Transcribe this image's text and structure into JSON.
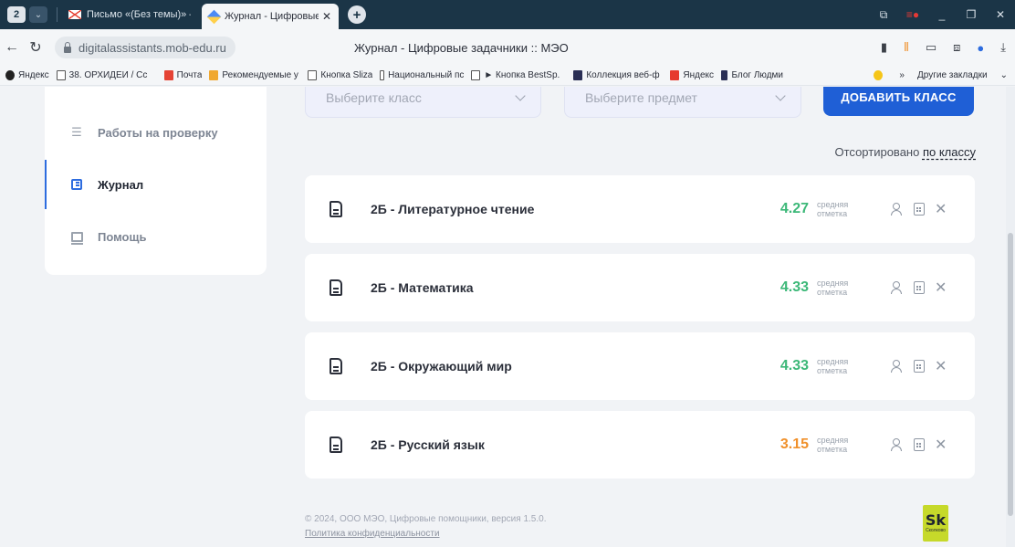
{
  "browser": {
    "tab_count": "2",
    "tabs": [
      {
        "title": "Письмо «(Без темы)» — М",
        "icon": "gmail-icon"
      },
      {
        "title": "Журнал - Цифровые за",
        "icon": "app-icon"
      }
    ],
    "url": "digitalassistants.mob-edu.ru",
    "page_title": "Журнал - Цифровые задачники :: МЭО",
    "bookmarks": [
      {
        "label": "Яндекс",
        "icon": "yandex-icon"
      },
      {
        "label": "38. ОРХИДЕИ / Сс",
        "icon": "page-icon"
      },
      {
        "label": "Почта",
        "icon": "mail-icon"
      },
      {
        "label": "Рекомендуемые у",
        "icon": "recommended-icon"
      },
      {
        "label": "Кнопка Sliza",
        "icon": "page-icon"
      },
      {
        "label": "Национальный пс",
        "icon": "page-icon"
      },
      {
        "label": "► Кнопка BestSp.",
        "icon": "page-icon"
      },
      {
        "label": "Коллекция веб-ф",
        "icon": "collection-icon"
      },
      {
        "label": "Яндекс",
        "icon": "yandex-icon"
      },
      {
        "label": "Блог Людми",
        "icon": "blog-icon"
      }
    ],
    "more_bookmarks": "»",
    "other_bookmarks": "Другие закладки"
  },
  "sidebar": {
    "items": [
      {
        "label": "Работы на проверку",
        "icon": "checklist-icon",
        "active": false
      },
      {
        "label": "Журнал",
        "icon": "journal-icon",
        "active": true
      },
      {
        "label": "Помощь",
        "icon": "help-icon",
        "active": false
      }
    ]
  },
  "filters": {
    "class_placeholder": "Выберите класс",
    "subject_placeholder": "Выберите предмет",
    "add_button": "ДОБАВИТЬ КЛАСС"
  },
  "sort": {
    "label": "Отсортировано",
    "value": "по классу"
  },
  "journals": [
    {
      "title": "2Б - Литературное чтение",
      "avg": "4.27",
      "avg_color": "#3cb878"
    },
    {
      "title": "2Б - Математика",
      "avg": "4.33",
      "avg_color": "#3cb878"
    },
    {
      "title": "2Б - Окружающий мир",
      "avg": "4.33",
      "avg_color": "#3cb878"
    },
    {
      "title": "2Б - Русский язык",
      "avg": "3.15",
      "avg_color": "#f0902a"
    }
  ],
  "avg_label_line1": "средняя",
  "avg_label_line2": "отметка",
  "footer": {
    "copyright": "© 2024, ООО МЭО, Цифровые помощники, версия 1.5.0.",
    "privacy": "Политика конфиденциальности",
    "logo_text": "Sk",
    "logo_sub": "Сколково"
  },
  "colors": {
    "accent": "#1f5fd6",
    "good": "#3cb878",
    "warn": "#f0902a",
    "chrome": "#1b3547"
  }
}
